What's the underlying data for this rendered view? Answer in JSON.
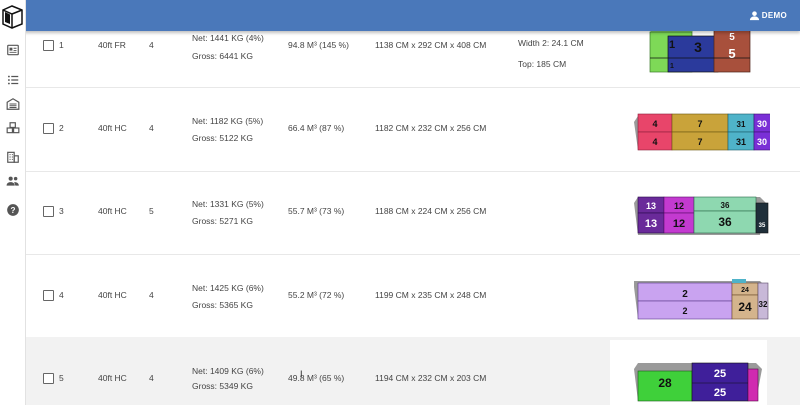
{
  "header": {
    "user_label": "DEMO"
  },
  "sidebar": {
    "items": [
      "logo",
      "document-icon",
      "list-icon",
      "warehouse-icon",
      "boxes-icon",
      "building-icon",
      "people-icon",
      "help-icon"
    ]
  },
  "rows": [
    {
      "index": "1",
      "type": "40ft FR",
      "count": "4",
      "net": "Net: 1441 KG (4%)",
      "gross": "Gross: 6441 KG",
      "volume": "94.8 M³ (145 %)",
      "dims": "1138 CM x 292 CM x 408 CM",
      "extra1": "Width 2: 24.1 CM",
      "extra2": "Top: 185 CM",
      "labels": [
        "1",
        "3",
        "5",
        "5",
        "1"
      ]
    },
    {
      "index": "2",
      "type": "40ft HC",
      "count": "4",
      "net": "Net: 1182 KG (5%)",
      "gross": "Gross: 5122 KG",
      "volume": "66.4 M³ (87 %)",
      "dims": "1182 CM x 232 CM x 256 CM",
      "labels": [
        "4",
        "7",
        "31",
        "30",
        "4",
        "7",
        "31",
        "30"
      ]
    },
    {
      "index": "3",
      "type": "40ft HC",
      "count": "5",
      "net": "Net: 1331 KG (5%)",
      "gross": "Gross: 5271 KG",
      "volume": "55.7 M³ (73 %)",
      "dims": "1188 CM x 224 CM x 256 CM",
      "labels": [
        "13",
        "12",
        "36",
        "13",
        "12",
        "36",
        "35"
      ]
    },
    {
      "index": "4",
      "type": "40ft HC",
      "count": "4",
      "net": "Net: 1425 KG (6%)",
      "gross": "Gross: 5365 KG",
      "volume": "55.2 M³ (72 %)",
      "dims": "1199 CM x 235 CM x 248 CM",
      "labels": [
        "2",
        "24",
        "2",
        "24",
        "32"
      ]
    },
    {
      "index": "5",
      "type": "40ft HC",
      "count": "4",
      "net": "Net: 1409 KG (6%)",
      "gross": "Gross: 5349 KG",
      "volume": "49.8 M³ (65 %)",
      "dims": "1194 CM x 232 CM x 203 CM",
      "labels": [
        "25",
        "28",
        "25"
      ]
    }
  ],
  "colors": {
    "header": "#4a78ba",
    "green": "#7ed957",
    "navy": "#2b3a9c",
    "brown": "#a8503c",
    "red": "#e8456a",
    "gold": "#c9a33a",
    "teal": "#4fb3c9",
    "purple": "#7a2fd6",
    "magenta": "#a23bd0",
    "mint": "#8ed8b0",
    "lavender": "#c9a3f0",
    "tan": "#d4b48c",
    "darkpurple": "#3f1f9a"
  }
}
